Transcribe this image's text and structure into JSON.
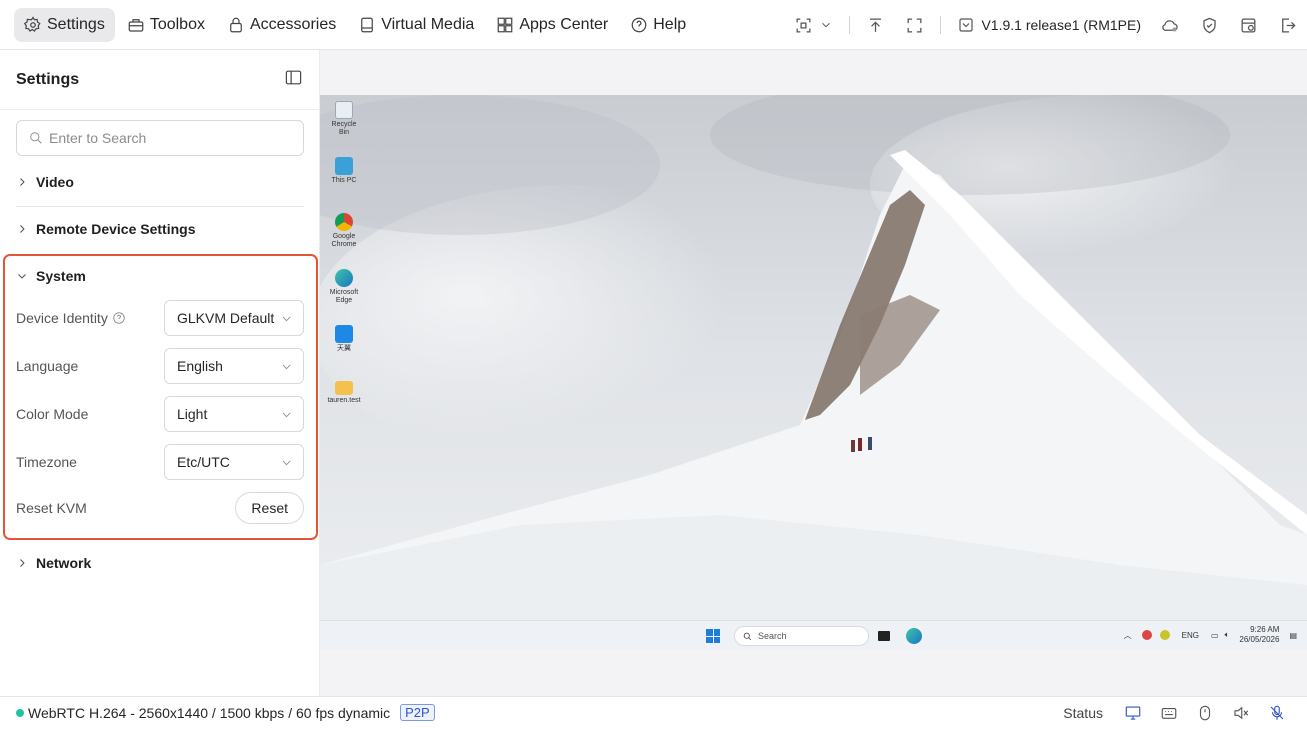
{
  "nav": {
    "items": [
      {
        "label": "Settings",
        "icon": "gear-icon",
        "active": true
      },
      {
        "label": "Toolbox",
        "icon": "toolbox-icon"
      },
      {
        "label": "Accessories",
        "icon": "lock-icon"
      },
      {
        "label": "Virtual Media",
        "icon": "drive-icon"
      },
      {
        "label": "Apps Center",
        "icon": "apps-grid-icon"
      },
      {
        "label": "Help",
        "icon": "help-icon"
      }
    ]
  },
  "toolbar": {
    "version": "V1.9.1 release1 (RM1PE)",
    "icons": [
      "screenshot-icon",
      "chevron-down-icon",
      "upload-icon",
      "fullscreen-icon",
      "cloud-icon",
      "shield-icon",
      "history-icon",
      "logout-icon"
    ]
  },
  "sidebar": {
    "title": "Settings",
    "search_placeholder": "Enter to Search",
    "sections": {
      "video": "Video",
      "remote_device": "Remote Device Settings",
      "system": "System",
      "network": "Network"
    },
    "system": {
      "device_identity_label": "Device Identity",
      "device_identity_value": "GLKVM Default",
      "language_label": "Language",
      "language_value": "English",
      "color_mode_label": "Color Mode",
      "color_mode_value": "Light",
      "timezone_label": "Timezone",
      "timezone_value": "Etc/UTC",
      "reset_label": "Reset KVM",
      "reset_button": "Reset"
    }
  },
  "remote": {
    "desktop_icons": [
      "Recycle Bin",
      "This PC",
      "Google Chrome",
      "Microsoft Edge",
      "天翼",
      "tauren.test"
    ],
    "taskbar_search": "Search",
    "tray_lang": "ENG",
    "clock_time": "9:26 AM",
    "clock_date": "26/05/2026"
  },
  "statusbar": {
    "stream": "WebRTC H.264 - 2560x1440 / 1500 kbps / 60 fps dynamic",
    "mode": "P2P",
    "status_label": "Status",
    "indicator_color": "#21c4a0"
  }
}
